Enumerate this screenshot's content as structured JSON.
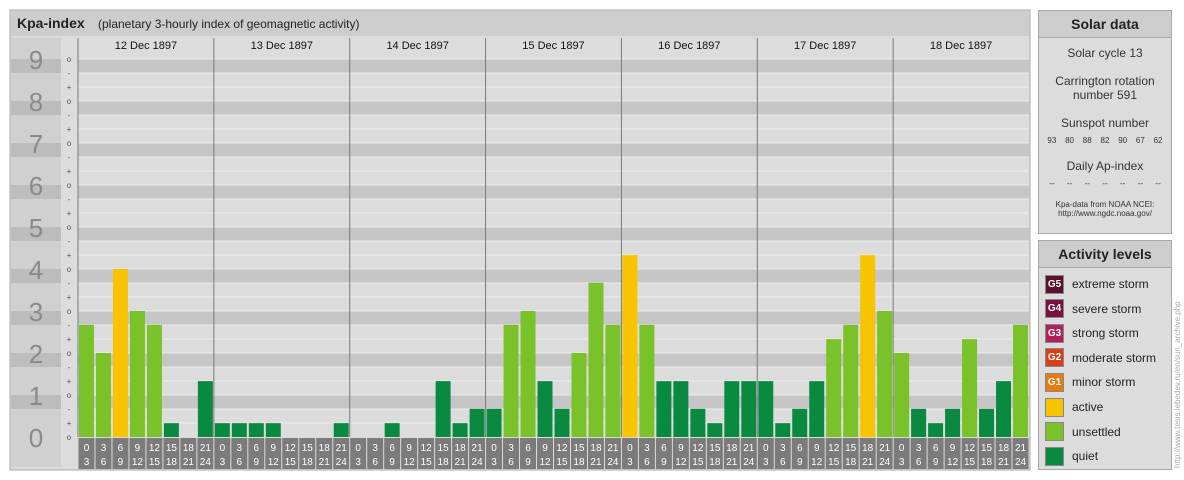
{
  "title": "Kpa-index",
  "subtitle": "(planetary 3-hourly index of geomagnetic activity)",
  "chart_data": {
    "type": "bar",
    "title": "Kpa-index",
    "subtitle": "(planetary 3-hourly index of geomagnetic activity)",
    "ylim": [
      0,
      9
    ],
    "y_ticks": [
      "0",
      "1",
      "2",
      "3",
      "4",
      "5",
      "6",
      "7",
      "8",
      "9"
    ],
    "days": [
      "12 Dec 1897",
      "13 Dec 1897",
      "14 Dec 1897",
      "15 Dec 1897",
      "16 Dec 1897",
      "17 Dec 1897",
      "18 Dec 1897"
    ],
    "hour_labels_top": [
      "0",
      "3",
      "6",
      "9",
      "12",
      "15",
      "18",
      "21"
    ],
    "hour_labels_bottom": [
      "3",
      "6",
      "9",
      "12",
      "15",
      "18",
      "21",
      "24"
    ],
    "values": [
      [
        2.67,
        2.0,
        4.0,
        3.0,
        2.67,
        0.33,
        0.0,
        1.33
      ],
      [
        0.33,
        0.33,
        0.33,
        0.33,
        0.0,
        0.0,
        0.0,
        0.33
      ],
      [
        0.0,
        0.0,
        0.33,
        0.0,
        0.0,
        1.33,
        0.33,
        0.67
      ],
      [
        0.67,
        2.67,
        3.0,
        1.33,
        0.67,
        2.0,
        3.67,
        2.67
      ],
      [
        4.33,
        2.67,
        1.33,
        1.33,
        0.67,
        0.33,
        1.33,
        1.33
      ],
      [
        1.33,
        0.33,
        0.67,
        1.33,
        2.33,
        2.67,
        4.33,
        3.0
      ],
      [
        2.0,
        0.67,
        0.33,
        0.67,
        2.33,
        0.67,
        1.33,
        2.67
      ]
    ],
    "colors": {
      "quiet": "#0a8a40",
      "unsettled": "#7ac22a",
      "active": "#f8c400"
    }
  },
  "solar": {
    "title": "Solar data",
    "cycle": "Solar cycle 13",
    "carrington_line1": "Carrington rotation",
    "carrington_line2": "number 591",
    "sunspot_label": "Sunspot number",
    "sunspots": [
      "93",
      "80",
      "88",
      "82",
      "90",
      "67",
      "62"
    ],
    "ap_label": "Daily Ap-index",
    "ap": [
      "--",
      "--",
      "--",
      "--",
      "--",
      "--",
      "--"
    ],
    "source_line1": "Kpa-data from NOAA NCEI:",
    "source_line2": "http://www.ngdc.noaa.gov/"
  },
  "activity": {
    "title": "Activity levels",
    "levels": [
      {
        "badge": "G5",
        "label": "extreme storm",
        "color": "#5a0f2a"
      },
      {
        "badge": "G4",
        "label": "severe storm",
        "color": "#7a1040"
      },
      {
        "badge": "G3",
        "label": "strong storm",
        "color": "#b0205a"
      },
      {
        "badge": "G2",
        "label": "moderate storm",
        "color": "#d8401a"
      },
      {
        "badge": "G1",
        "label": "minor storm",
        "color": "#e87a12"
      },
      {
        "badge": "",
        "label": "active",
        "color": "#f8c400"
      },
      {
        "badge": "",
        "label": "unsettled",
        "color": "#7ac22a"
      },
      {
        "badge": "",
        "label": "quiet",
        "color": "#0a8a40"
      }
    ]
  },
  "credit": "http://www.tesis.lebedev.ru/en/sun_archive.php"
}
